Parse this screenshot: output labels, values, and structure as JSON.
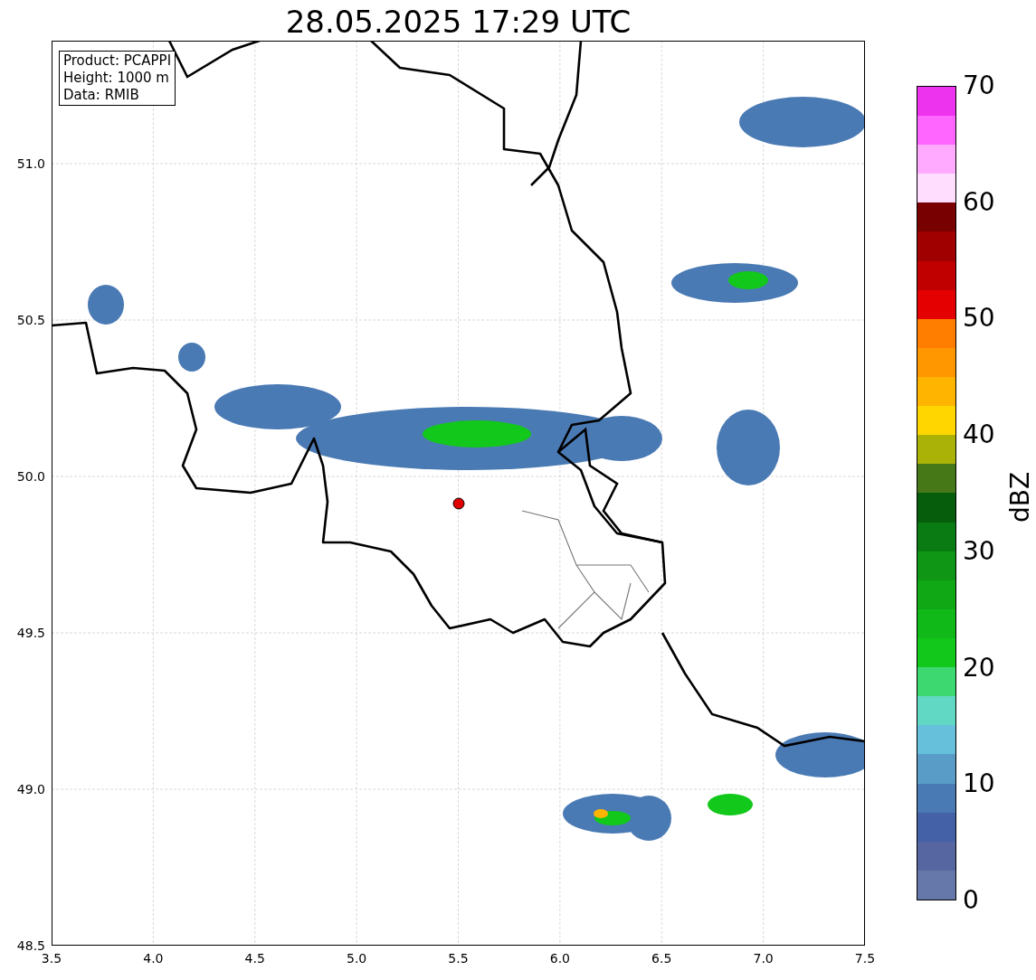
{
  "title": "28.05.2025 17:29 UTC",
  "info_box": [
    "Product: PCAPPI",
    "Height: 1000 m",
    "Data: RMIB"
  ],
  "map": {
    "xticks": [
      "3.5",
      "4.0",
      "4.5",
      "5.0",
      "5.5",
      "6.0",
      "6.5",
      "7.0",
      "7.5"
    ],
    "yticks": [
      "51.0",
      "50.5",
      "50.0",
      "49.5",
      "49.0",
      "48.5"
    ]
  },
  "colorbar": {
    "label": "dBZ",
    "ticks": [
      "70",
      "60",
      "50",
      "40",
      "30",
      "20",
      "10",
      "0"
    ],
    "bands": [
      {
        "color": "#6677aa"
      },
      {
        "color": "#5566a0"
      },
      {
        "color": "#4460a6"
      },
      {
        "color": "#4a7ab4"
      },
      {
        "color": "#5a9cc8"
      },
      {
        "color": "#66c0dc"
      },
      {
        "color": "#60d8c4"
      },
      {
        "color": "#3ed870"
      },
      {
        "color": "#12c81a"
      },
      {
        "color": "#10b818"
      },
      {
        "color": "#10a814"
      },
      {
        "color": "#0e9614"
      },
      {
        "color": "#0a7a12"
      },
      {
        "color": "#065e0c"
      },
      {
        "color": "#467818"
      },
      {
        "color": "#aab208"
      },
      {
        "color": "#ffd600"
      },
      {
        "color": "#ffb400"
      },
      {
        "color": "#ff9800"
      },
      {
        "color": "#ff7e00"
      },
      {
        "color": "#e40000"
      },
      {
        "color": "#c00000"
      },
      {
        "color": "#a00000"
      },
      {
        "color": "#780000"
      },
      {
        "color": "#ffddff"
      },
      {
        "color": "#ffaaff"
      },
      {
        "color": "#ff66ff"
      },
      {
        "color": "#ee33ee"
      }
    ]
  }
}
